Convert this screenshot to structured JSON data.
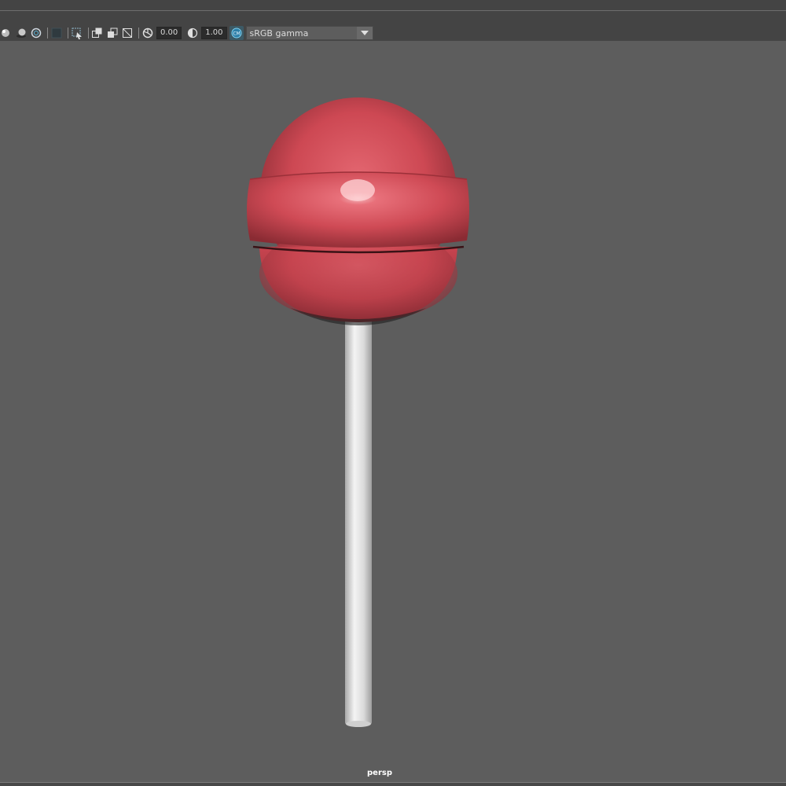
{
  "toolbar": {
    "exposure_value": "0.00",
    "gamma_value": "1.00",
    "color_management_label": "sRGB gamma"
  },
  "icons": [
    "lighting-icon",
    "shadow-icon",
    "wireframe-icon",
    "shaded-icon",
    "isolate-icon",
    "xray-icon",
    "xray-joints-icon",
    "xray-components-icon",
    "exposure-icon",
    "gamma-icon",
    "color-management-icon",
    "dropdown-arrow-icon"
  ],
  "viewport": {
    "camera_label": "persp",
    "background_color": "#5d5d5d",
    "object": "lollipop",
    "candy_color": "#c9454f",
    "stick_color": "#e6e6e6"
  }
}
